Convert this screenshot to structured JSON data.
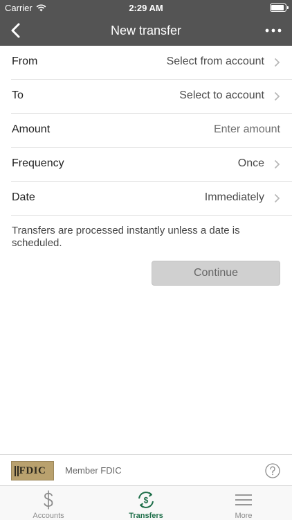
{
  "status_bar": {
    "carrier": "Carrier",
    "time": "2:29 AM",
    "battery_level": 0.9
  },
  "nav": {
    "title": "New transfer",
    "back_icon": "chevron-left-icon",
    "more_icon": "more-dots-icon"
  },
  "form": {
    "rows": [
      {
        "label": "From",
        "value": "Select from account",
        "has_chevron": true
      },
      {
        "label": "To",
        "value": "Select to account",
        "has_chevron": true
      },
      {
        "label": "Amount",
        "value": "Enter amount",
        "has_chevron": false
      },
      {
        "label": "Frequency",
        "value": "Once",
        "has_chevron": true
      },
      {
        "label": "Date",
        "value": "Immediately",
        "has_chevron": true
      }
    ],
    "note": "Transfers are processed instantly unless a date is scheduled.",
    "continue_label": "Continue"
  },
  "fdic": {
    "logo_text": "FDIC",
    "member_text": "Member FDIC",
    "help_icon": "question-circle-icon"
  },
  "tabs": [
    {
      "label": "Accounts",
      "icon": "dollar-icon",
      "active": false
    },
    {
      "label": "Transfers",
      "icon": "transfer-cycle-icon",
      "active": true
    },
    {
      "label": "More",
      "icon": "hamburger-menu-icon",
      "active": false
    }
  ],
  "colors": {
    "header_bg": "#545454",
    "active_tab": "#1f6f4a",
    "inactive_tab": "#8a8a8a",
    "fdic_gold": "#b9a16e"
  }
}
